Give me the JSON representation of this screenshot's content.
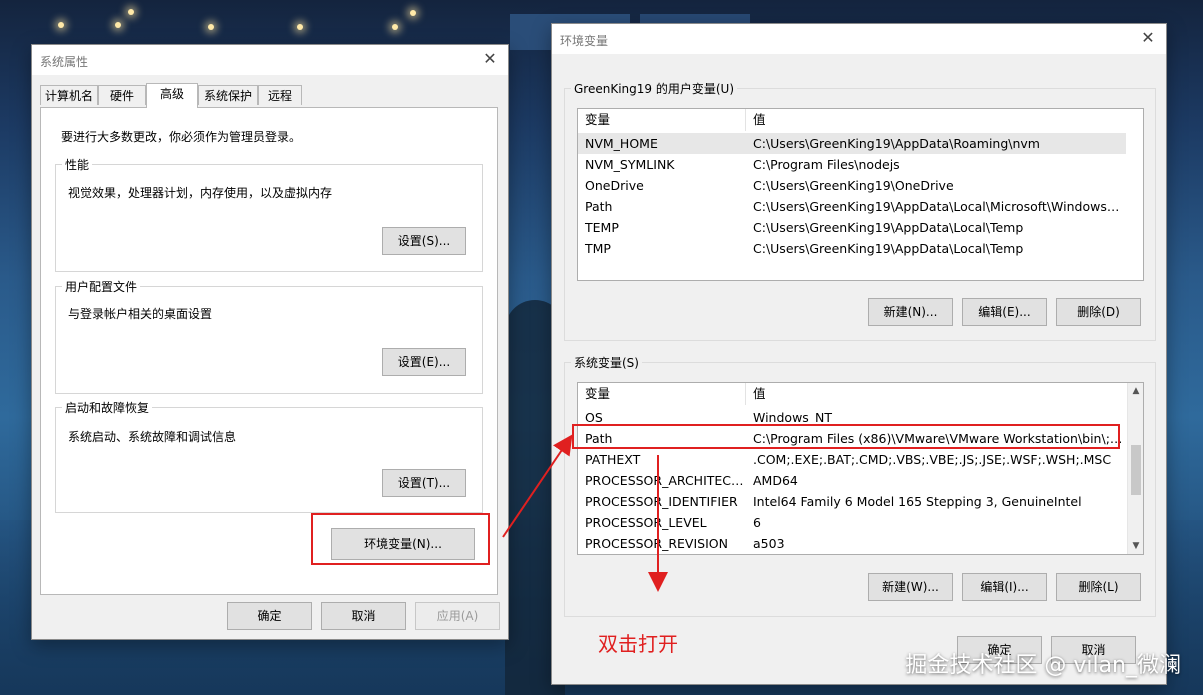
{
  "sys_props": {
    "title": "系统属性",
    "close": "✕",
    "tabs": [
      "计算机名",
      "硬件",
      "高级",
      "系统保护",
      "远程"
    ],
    "admin_note": "要进行大多数更改，你必须作为管理员登录。",
    "performance": {
      "label": "性能",
      "desc": "视觉效果，处理器计划，内存使用，以及虚拟内存",
      "button": "设置(S)..."
    },
    "user_profiles": {
      "label": "用户配置文件",
      "desc": "与登录帐户相关的桌面设置",
      "button": "设置(E)..."
    },
    "startup": {
      "label": "启动和故障恢复",
      "desc": "系统启动、系统故障和调试信息",
      "button": "设置(T)..."
    },
    "env_button": "环境变量(N)...",
    "ok": "确定",
    "cancel": "取消",
    "apply": "应用(A)"
  },
  "env_vars": {
    "title": "环境变量",
    "close": "✕",
    "user_section": "GreenKing19 的用户变量(U)",
    "col_var": "变量",
    "col_val": "值",
    "user_rows": [
      {
        "name": "NVM_HOME",
        "value": "C:\\Users\\GreenKing19\\AppData\\Roaming\\nvm"
      },
      {
        "name": "NVM_SYMLINK",
        "value": "C:\\Program Files\\nodejs"
      },
      {
        "name": "OneDrive",
        "value": "C:\\Users\\GreenKing19\\OneDrive"
      },
      {
        "name": "Path",
        "value": "C:\\Users\\GreenKing19\\AppData\\Local\\Microsoft\\WindowsAp..."
      },
      {
        "name": "TEMP",
        "value": "C:\\Users\\GreenKing19\\AppData\\Local\\Temp"
      },
      {
        "name": "TMP",
        "value": "C:\\Users\\GreenKing19\\AppData\\Local\\Temp"
      }
    ],
    "user_buttons": {
      "new": "新建(N)...",
      "edit": "编辑(E)...",
      "delete": "删除(D)"
    },
    "sys_section": "系统变量(S)",
    "sys_rows": [
      {
        "name": "OS",
        "value": "Windows_NT"
      },
      {
        "name": "Path",
        "value": "C:\\Program Files (x86)\\VMware\\VMware Workstation\\bin\\;C:\\..."
      },
      {
        "name": "PATHEXT",
        "value": ".COM;.EXE;.BAT;.CMD;.VBS;.VBE;.JS;.JSE;.WSF;.WSH;.MSC"
      },
      {
        "name": "PROCESSOR_ARCHITECT...",
        "value": "AMD64"
      },
      {
        "name": "PROCESSOR_IDENTIFIER",
        "value": "Intel64 Family 6 Model 165 Stepping 3, GenuineIntel"
      },
      {
        "name": "PROCESSOR_LEVEL",
        "value": "6"
      },
      {
        "name": "PROCESSOR_REVISION",
        "value": "a503"
      }
    ],
    "sys_buttons": {
      "new": "新建(W)...",
      "edit": "编辑(I)...",
      "delete": "删除(L)"
    },
    "ok": "确定",
    "cancel": "取消"
  },
  "annotation": {
    "text": "双击打开",
    "color": "#e02020"
  },
  "watermark": "掘金技术社区 @ vilan_微澜"
}
